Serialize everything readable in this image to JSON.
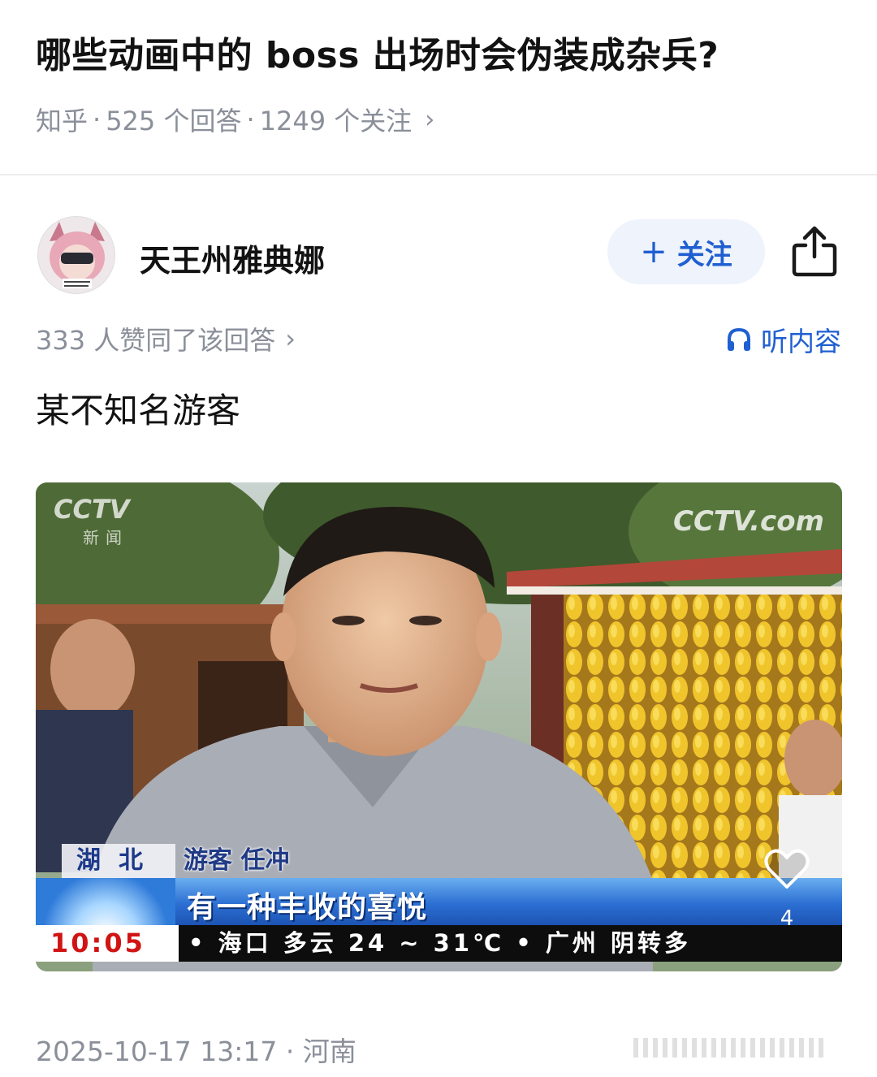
{
  "question": {
    "title": "哪些动画中的 boss 出场时会伪装成杂兵?",
    "source": "知乎",
    "answers": "525 个回答",
    "followers": "1249 个关注",
    "sep": "·"
  },
  "author": {
    "name": "天王州雅典娜",
    "follow_label": "关注",
    "follow_plus": "+"
  },
  "answer": {
    "likes_text": "333 人赞同了该回答",
    "listen_label": "听内容",
    "text": "某不知名游客",
    "date_location": "2025-10-17 13:17 · 河南"
  },
  "photo": {
    "cctv_logo": "CCTV",
    "cctv_sub": "新闻",
    "cctv_right": "CCTV.com",
    "location_tag": "湖北",
    "person_tag": "游客 任冲",
    "ticker_text": "有一种丰收的喜悦",
    "clock": "10:05",
    "weather": "• 海口  多云  24 ~ 31℃  • 广州  阴转多",
    "like_count": "4"
  },
  "icons": {
    "share": "share-icon",
    "headphones": "headphones-icon",
    "heart": "heart-icon",
    "chevron": "chevron-right-icon"
  },
  "colors": {
    "accent": "#1f5fd1",
    "meta_gray": "#8a8f99",
    "follow_bg": "#eef3fc"
  }
}
